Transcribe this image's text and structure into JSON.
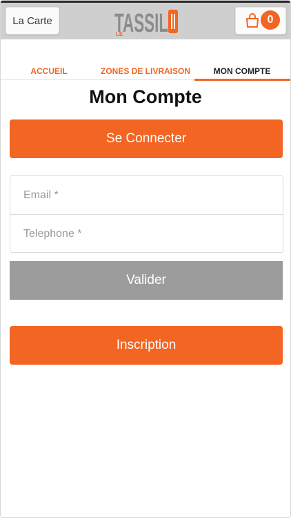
{
  "header": {
    "menu_label": "La Carte",
    "logo_text": "TASSIL",
    "logo_prefix": "LE",
    "cart_count": "0",
    "colors": {
      "accent": "#f26522",
      "bar": "#cfcfcf"
    },
    "icons": {
      "cart": "shopping-bag-icon"
    }
  },
  "tabs": [
    {
      "label": "ACCUEIL",
      "active": false
    },
    {
      "label": "ZONES DE LIVRAISON",
      "active": false
    },
    {
      "label": "MON COMPTE",
      "active": true
    }
  ],
  "page": {
    "title": "Mon Compte",
    "login_button": "Se Connecter",
    "email_placeholder": "Email *",
    "email_value": "",
    "phone_placeholder": "Telephone *",
    "phone_value": "",
    "submit_button": "Valider",
    "signup_button": "Inscription"
  },
  "colors": {
    "primary": "#f26522",
    "disabled": "#9c9c9c",
    "text": "#111111"
  }
}
